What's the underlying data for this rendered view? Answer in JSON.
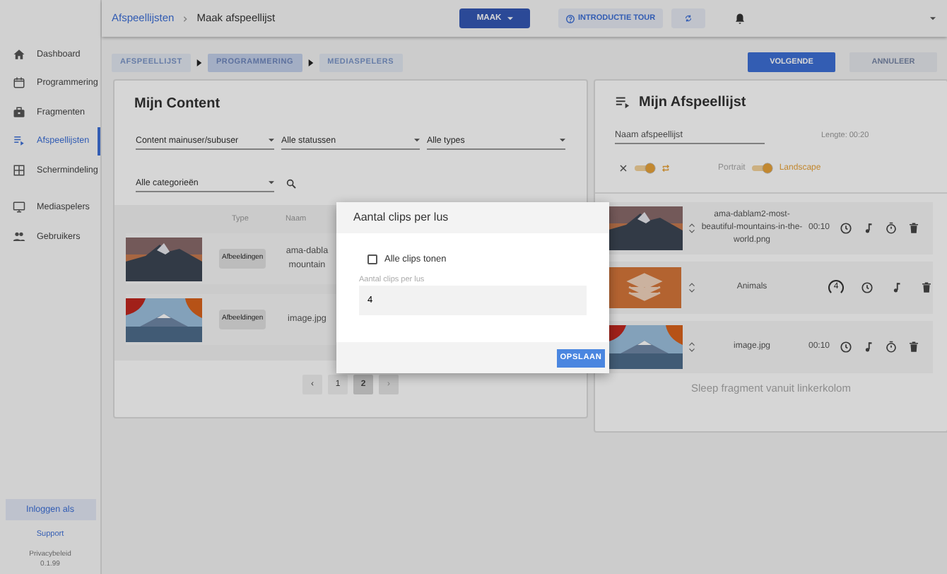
{
  "topbar": {
    "breadcrumb": [
      "Afspeellijsten",
      "Maak afspeellijst"
    ],
    "create_button": "MAAK",
    "tour_button": "INTRODUCTIE TOUR"
  },
  "sidebar": {
    "items": [
      {
        "label": "Dashboard",
        "selected": false
      },
      {
        "label": "Programmering",
        "selected": false
      },
      {
        "label": "Fragmenten",
        "selected": false
      },
      {
        "label": "Afspeellijsten",
        "selected": true
      },
      {
        "label": "Schermindeling",
        "selected": false
      },
      {
        "label": "Mediaspelers",
        "selected": false
      },
      {
        "label": "Gebruikers",
        "selected": false
      }
    ],
    "login_button": "Inloggen als",
    "support_link": "Support",
    "privacy_link": "Privacybeleid",
    "version": "0.1.99"
  },
  "steps": [
    {
      "label": "AFSPEELLIJST",
      "selected": false
    },
    {
      "label": "PROGRAMMERING",
      "selected": true
    },
    {
      "label": "MEDIASPELERS",
      "selected": false
    }
  ],
  "actions": {
    "next_button": "VOLGENDE",
    "cancel_button": "ANNULEER"
  },
  "content": {
    "title": "Mijn Content",
    "filters": [
      "Content mainuser/subuser",
      "Alle statussen",
      "Alle types"
    ],
    "category_filter": "Alle categorieën",
    "columns": [
      "Type",
      "Naam"
    ],
    "rows": [
      {
        "type": "Afbeeldingen",
        "name": "ama-dabla\nmountain"
      },
      {
        "type": "Afbeeldingen",
        "name": "image.jpg"
      }
    ],
    "pagination": [
      {
        "label": "‹",
        "selected": false,
        "disabled": false
      },
      {
        "label": "1",
        "selected": false,
        "disabled": false
      },
      {
        "label": "2",
        "selected": true,
        "disabled": false
      },
      {
        "label": "›",
        "selected": false,
        "disabled": true
      }
    ]
  },
  "playlist": {
    "title": "Mijn Afspeellijst",
    "name_placeholder": "Naam afspeellijst",
    "length_label": "Lengte:",
    "length_value": "00:20",
    "repeat_on": true,
    "orientation": [
      {
        "label": "Portrait",
        "selected": false
      },
      {
        "label": "Landscape",
        "selected": true
      }
    ],
    "items": [
      {
        "kind": "image",
        "name": "ama-dablam2-most-beautiful-mountains-in-the-world.png",
        "duration": "00:10"
      },
      {
        "kind": "playlist",
        "name": "Animals",
        "loop_count": "4"
      },
      {
        "kind": "image",
        "name": "image.jpg",
        "duration": "00:10"
      }
    ],
    "drop_hint": "Sleep fragment vanuit linkerkolom"
  },
  "modal": {
    "title": "Aantal clips per lus",
    "checkbox": {
      "label": "Alle clips tonen",
      "checked": false
    },
    "field_label": "Aantal clips per lus",
    "field_value": "4",
    "save_button": "OPSLAAN"
  }
}
